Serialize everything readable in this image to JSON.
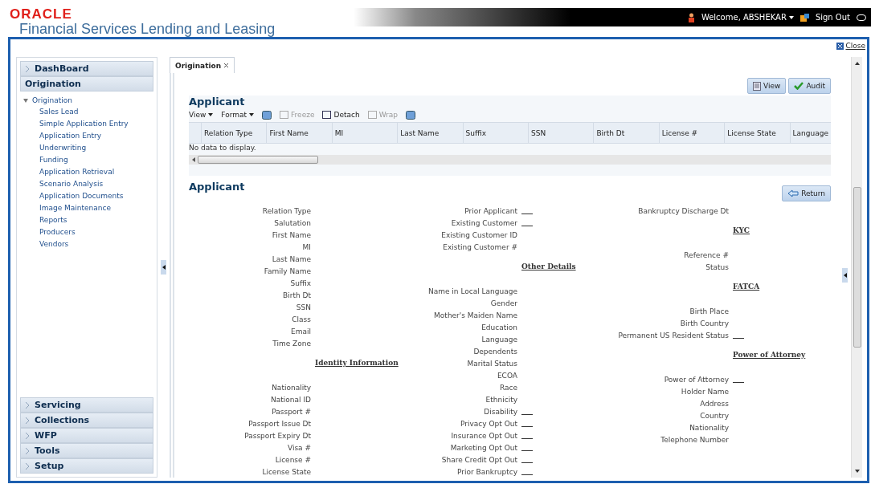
{
  "header": {
    "brand": "ORACLE",
    "product": "Financial Services Lending and Leasing",
    "welcome": "Welcome, ABSHEKAR",
    "sign_out": "Sign Out"
  },
  "sidebar": {
    "sections": [
      {
        "label": "DashBoard",
        "expanded": false
      },
      {
        "label": "Origination",
        "expanded": true,
        "tree": [
          {
            "label": "Origination",
            "expanded": true,
            "children": [
              {
                "label": "Sales Lead"
              },
              {
                "label": "Simple Application Entry"
              },
              {
                "label": "Application Entry"
              },
              {
                "label": "Underwriting"
              },
              {
                "label": "Funding"
              },
              {
                "label": "Application Retrieval"
              },
              {
                "label": "Scenario Analysis"
              },
              {
                "label": "Application Documents"
              },
              {
                "label": "Image Maintenance"
              },
              {
                "label": "Reports"
              },
              {
                "label": "Producers"
              },
              {
                "label": "Vendors"
              }
            ]
          }
        ]
      },
      {
        "label": "Servicing",
        "expanded": false
      },
      {
        "label": "Collections",
        "expanded": false
      },
      {
        "label": "WFP",
        "expanded": false
      },
      {
        "label": "Tools",
        "expanded": false
      },
      {
        "label": "Setup",
        "expanded": false
      }
    ]
  },
  "tabs": [
    {
      "label": "Origination",
      "selected": true
    }
  ],
  "close_link": "Close",
  "applicant_table": {
    "title": "Applicant",
    "toolbar": [
      {
        "kind": "menu",
        "label": "View",
        "disabled": false
      },
      {
        "kind": "menu",
        "label": "Format",
        "disabled": false
      },
      {
        "kind": "icon",
        "disabled": false
      },
      {
        "kind": "button",
        "label": "Freeze",
        "disabled": true
      },
      {
        "kind": "button",
        "label": "Detach",
        "disabled": false
      },
      {
        "kind": "button",
        "label": "Wrap",
        "disabled": true
      },
      {
        "kind": "icon",
        "disabled": false
      }
    ],
    "buttons": [
      "View",
      "Audit"
    ],
    "columns": [
      "Relation Type",
      "First Name",
      "MI",
      "Last Name",
      "Suffix",
      "SSN",
      "Birth Dt",
      "License #",
      "License State",
      "Language"
    ],
    "empty_text": "No data to display."
  },
  "applicant_form": {
    "title": "Applicant",
    "return_button": "Return",
    "columns": [
      [
        {
          "kind": "text",
          "label": "Relation Type"
        },
        {
          "kind": "text",
          "label": "Salutation"
        },
        {
          "kind": "text",
          "label": "First Name"
        },
        {
          "kind": "text",
          "label": "MI"
        },
        {
          "kind": "text",
          "label": "Last Name"
        },
        {
          "kind": "text",
          "label": "Family Name"
        },
        {
          "kind": "text",
          "label": "Suffix"
        },
        {
          "kind": "text",
          "label": "Birth Dt"
        },
        {
          "kind": "text",
          "label": "SSN"
        },
        {
          "kind": "text",
          "label": "Class"
        },
        {
          "kind": "text",
          "label": "Email"
        },
        {
          "kind": "text",
          "label": "Time Zone"
        },
        {
          "kind": "heading",
          "label": "Identity Information"
        },
        {
          "kind": "text",
          "label": "Nationality"
        },
        {
          "kind": "text",
          "label": "National ID"
        },
        {
          "kind": "text",
          "label": "Passport #"
        },
        {
          "kind": "text",
          "label": "Passport Issue Dt"
        },
        {
          "kind": "text",
          "label": "Passport Expiry Dt"
        },
        {
          "kind": "text",
          "label": "Visa #"
        },
        {
          "kind": "text",
          "label": "License #"
        },
        {
          "kind": "text",
          "label": "License State"
        }
      ],
      [
        {
          "kind": "flag",
          "label": "Prior Applicant"
        },
        {
          "kind": "flag",
          "label": "Existing Customer"
        },
        {
          "kind": "text",
          "label": "Existing Customer ID"
        },
        {
          "kind": "text",
          "label": "Existing Customer #"
        },
        {
          "kind": "heading",
          "label": "Other Details"
        },
        {
          "kind": "text",
          "label": "Name in Local Language"
        },
        {
          "kind": "text",
          "label": "Gender"
        },
        {
          "kind": "text",
          "label": "Mother's Maiden Name"
        },
        {
          "kind": "text",
          "label": "Education"
        },
        {
          "kind": "text",
          "label": "Language"
        },
        {
          "kind": "text",
          "label": "Dependents"
        },
        {
          "kind": "text",
          "label": "Marital Status"
        },
        {
          "kind": "text",
          "label": "ECOA"
        },
        {
          "kind": "text",
          "label": "Race"
        },
        {
          "kind": "text",
          "label": "Ethnicity"
        },
        {
          "kind": "flag",
          "label": "Disability"
        },
        {
          "kind": "flag",
          "label": "Privacy Opt Out"
        },
        {
          "kind": "flag",
          "label": "Insurance Opt Out"
        },
        {
          "kind": "flag",
          "label": "Marketing Opt Out"
        },
        {
          "kind": "flag",
          "label": "Share Credit Opt Out"
        },
        {
          "kind": "flag",
          "label": "Prior Bankruptcy"
        }
      ],
      [
        {
          "kind": "text",
          "label": "Bankruptcy Discharge Dt"
        },
        {
          "kind": "heading",
          "label": "KYC"
        },
        {
          "kind": "text",
          "label": "Reference #"
        },
        {
          "kind": "text",
          "label": "Status"
        },
        {
          "kind": "heading",
          "label": "FATCA"
        },
        {
          "kind": "text",
          "label": "Birth Place"
        },
        {
          "kind": "text",
          "label": "Birth Country"
        },
        {
          "kind": "flag",
          "label": "Permanent US Resident Status"
        },
        {
          "kind": "heading",
          "label": "Power of Attorney"
        },
        {
          "kind": "flag",
          "label": "Power of Attorney"
        },
        {
          "kind": "text",
          "label": "Holder Name"
        },
        {
          "kind": "text",
          "label": "Address"
        },
        {
          "kind": "text",
          "label": "Country"
        },
        {
          "kind": "text",
          "label": "Nationality"
        },
        {
          "kind": "text",
          "label": "Telephone Number"
        }
      ]
    ]
  }
}
